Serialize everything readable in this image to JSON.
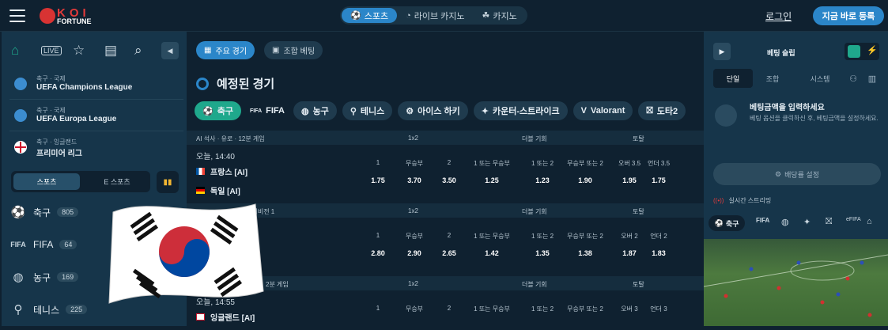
{
  "header": {
    "logo_top": "KOI",
    "logo_bottom": "FORTUNE",
    "tabs": [
      {
        "label": "스포츠",
        "icon": "sports-ball-icon"
      },
      {
        "label": "라이브 카지노",
        "icon": "casino-chip-icon"
      },
      {
        "label": "카지노",
        "icon": "cards-icon"
      }
    ],
    "login": "로그인",
    "register": "지금 바로 등록"
  },
  "sidebar": {
    "icons": [
      "home-icon",
      "live-icon",
      "star-icon",
      "betslip-icon",
      "search-icon"
    ],
    "leagues": [
      {
        "sub": "축구 · 국제",
        "name": "UEFA Champions League"
      },
      {
        "sub": "축구 · 국제",
        "name": "UEFA Europa League"
      },
      {
        "sub": "축구 · 잉글랜드",
        "name": "프리미어 리그"
      }
    ],
    "toggle_on": "스포츠",
    "toggle_off": "E 스포츠",
    "sports": [
      {
        "name": "축구",
        "count": "805"
      },
      {
        "name": "FIFA",
        "count": "64"
      },
      {
        "name": "농구",
        "count": "169"
      },
      {
        "name": "테니스",
        "count": "225"
      }
    ]
  },
  "main": {
    "chip1": "주요 경기",
    "chip2": "조합 베팅",
    "heading": "예정된 경기",
    "sports": [
      "축구",
      "FIFA",
      "농구",
      "테니스",
      "아이스 하키",
      "카운터-스트라이크",
      "Valorant",
      "도타2"
    ],
    "groups": [
      {
        "league": "AI 석사 · 유로 · 12분 게임",
        "h1": "1x2",
        "h2": "더블 기회",
        "h3": "토탈",
        "time": "오늘, 14:40",
        "team1": "프랑스 [AI]",
        "team2": "독일 [AI]",
        "labels": [
          "1",
          "무승부",
          "2",
          "1 또는 무승부",
          "1 또는 2",
          "무승부 또는 2",
          "오버 3.5",
          "언더 3.5"
        ],
        "odds": [
          "1.75",
          "3.70",
          "3.50",
          "1.25",
          "1.23",
          "1.90",
          "1.95",
          "1.75"
        ]
      },
      {
        "league": "아 · 디비전 1",
        "h1": "1x2",
        "h2": "더블 기회",
        "h3": "토탈",
        "time": "",
        "team1": "",
        "team2": "",
        "labels": [
          "1",
          "무승부",
          "2",
          "1 또는 무승부",
          "1 또는 2",
          "무승부 또는 2",
          "오버 2",
          "언더 2"
        ],
        "odds": [
          "2.80",
          "2.90",
          "2.65",
          "1.42",
          "1.35",
          "1.38",
          "1.87",
          "1.83"
        ]
      },
      {
        "league": "2분 게임",
        "h1": "1x2",
        "h2": "더블 기회",
        "h3": "토탈",
        "time": "오늘, 14:55",
        "team1": "잉글랜드 [AI]",
        "team2": "",
        "labels": [
          "1",
          "무승부",
          "2",
          "1 또는 무승부",
          "1 또는 2",
          "무승부 또는 2",
          "오버 3",
          "언더 3"
        ],
        "odds": []
      }
    ]
  },
  "right": {
    "title": "베팅 슬립",
    "tabs": [
      "단일",
      "조합",
      "시스템"
    ],
    "msg_title": "베팅금액을 입력하세요",
    "msg_body": "베팅 옵션을 클릭하신 후, 베팅금액을 설정하세요.",
    "set_button": "배당률 설정",
    "live_label": "실시간 스트리밍",
    "live_sport": "축구"
  },
  "colors": {
    "accent": "#2b86c9",
    "active_sport": "#1fa88c",
    "brand": "#e23a3a"
  }
}
